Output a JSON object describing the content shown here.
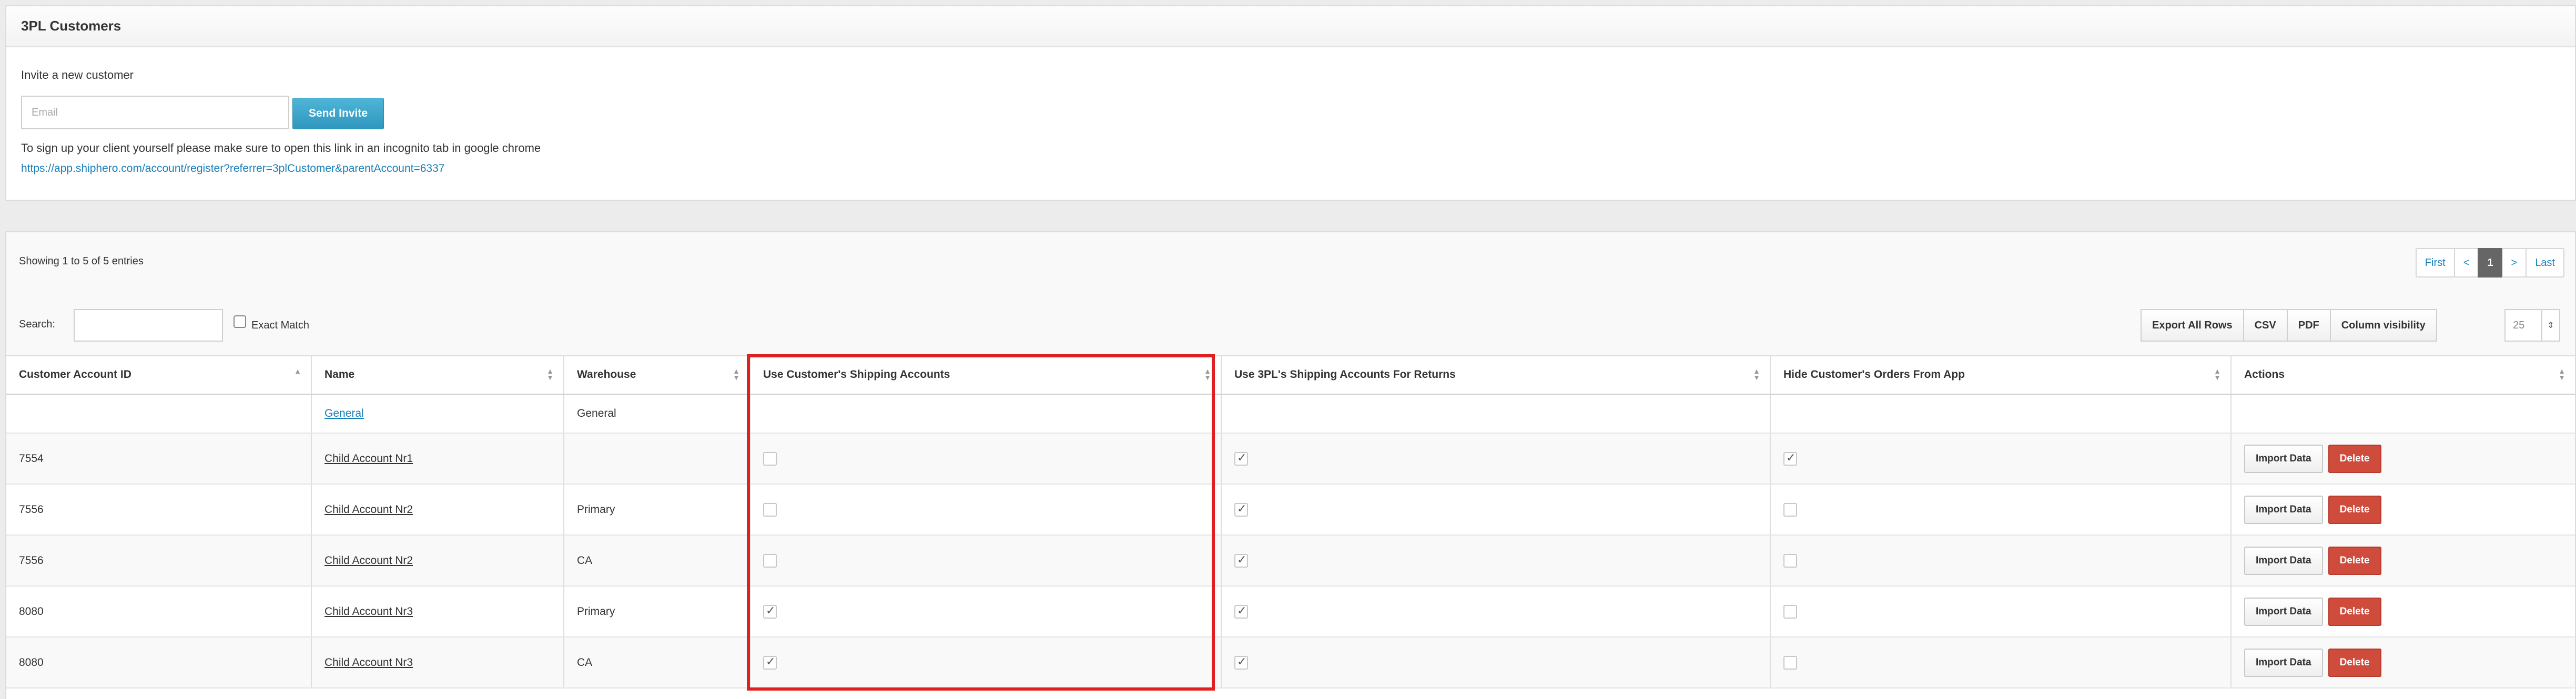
{
  "panel_title": "3PL Customers",
  "invite": {
    "label": "Invite a new customer",
    "email_placeholder": "Email",
    "send_label": "Send Invite",
    "note": "To sign up your client yourself please make sure to open this link in an incognito tab in google chrome",
    "link": "https://app.shiphero.com/account/register?referrer=3plCustomer&parentAccount=6337"
  },
  "table_info": "Showing 1 to 5 of 5 entries",
  "pagination": {
    "first": "First",
    "prev": "<",
    "current": "1",
    "next": ">",
    "last": "Last"
  },
  "search": {
    "label": "Search:",
    "exact_match": "Exact Match"
  },
  "export_buttons": [
    "Export All Rows",
    "CSV",
    "PDF",
    "Column visibility"
  ],
  "page_size": "25",
  "columns": [
    "Customer Account ID",
    "Name",
    "Warehouse",
    "Use Customer's Shipping Accounts",
    "Use 3PL's Shipping Accounts For Returns",
    "Hide Customer's Orders From App",
    "Actions"
  ],
  "rows": [
    {
      "id": "",
      "name": "General",
      "warehouse": "General",
      "use_customer": null,
      "use_3pl": null,
      "hide": null,
      "actions": false
    },
    {
      "id": "7554",
      "name": "Child Account Nr1",
      "warehouse": "",
      "use_customer": false,
      "use_3pl": true,
      "hide": true,
      "actions": true
    },
    {
      "id": "7556",
      "name": "Child Account Nr2",
      "warehouse": "Primary",
      "use_customer": false,
      "use_3pl": true,
      "hide": false,
      "actions": true
    },
    {
      "id": "7556",
      "name": "Child Account Nr2",
      "warehouse": "CA",
      "use_customer": false,
      "use_3pl": true,
      "hide": false,
      "actions": true
    },
    {
      "id": "8080",
      "name": "Child Account Nr3",
      "warehouse": "Primary",
      "use_customer": true,
      "use_3pl": true,
      "hide": false,
      "actions": true
    },
    {
      "id": "8080",
      "name": "Child Account Nr3",
      "warehouse": "CA",
      "use_customer": true,
      "use_3pl": true,
      "hide": false,
      "actions": true
    }
  ],
  "action_labels": {
    "import": "Import Data",
    "delete": "Delete"
  },
  "colors": {
    "accent": "#2f96bd",
    "delete": "#cf4b3b",
    "link": "#1a7fb8",
    "highlight": "#e02020"
  }
}
